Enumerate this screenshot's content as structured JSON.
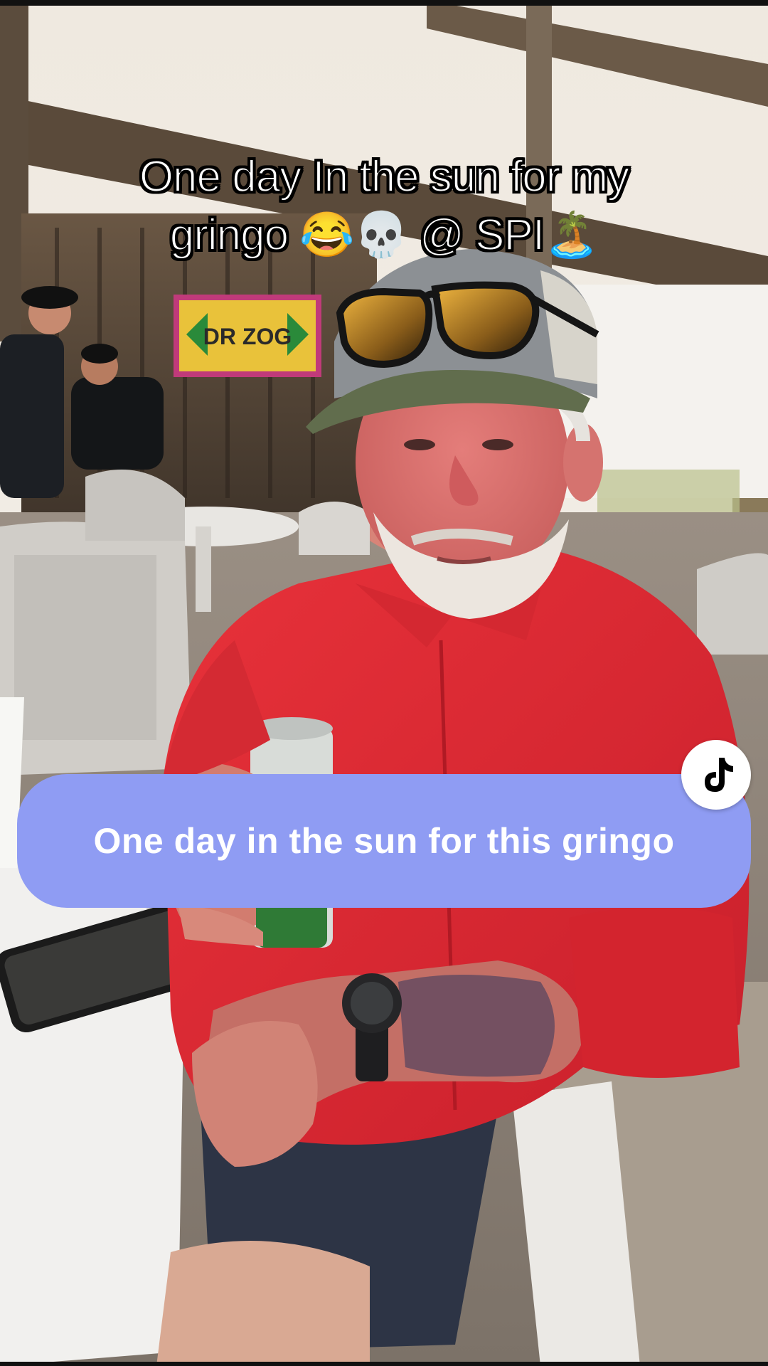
{
  "overlay": {
    "title_line1": "One day In the sun for my",
    "title_line2_text": "gringo",
    "title_line2_emoji1": "😂",
    "title_line2_emoji2": "💀",
    "title_line2_mention": "@ SPI",
    "title_line2_emoji3": "🏝️"
  },
  "caption": {
    "text": "One day in the sun for this gringo",
    "bubble_color": "#8f9cf3"
  },
  "badge": {
    "icon": "tiktok-logo-icon"
  },
  "photo": {
    "sign_text": "DR ZOG"
  }
}
